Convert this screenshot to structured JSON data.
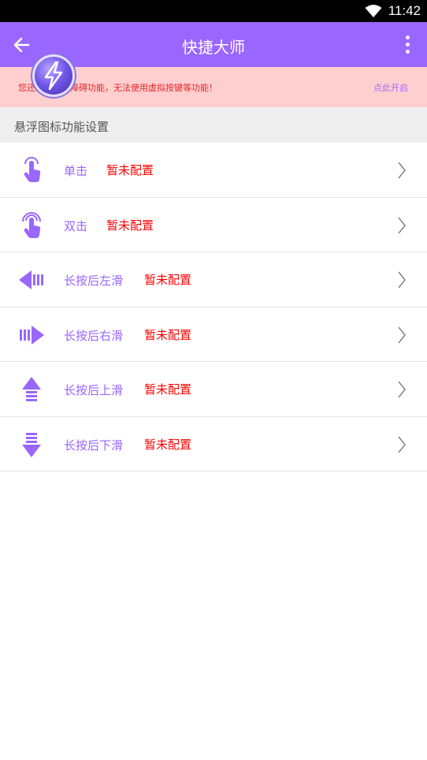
{
  "status": {
    "time": "11:42"
  },
  "appbar": {
    "title": "快捷大师"
  },
  "banner": {
    "message": "您还未开启无障碍功能，无法使用虚拟按键等功能！",
    "action": "点此开启"
  },
  "section": {
    "title": "悬浮图标功能设置"
  },
  "rows": [
    {
      "label": "单击",
      "value": "暂未配置",
      "icon": "single-tap-icon"
    },
    {
      "label": "双击",
      "value": "暂未配置",
      "icon": "double-tap-icon"
    },
    {
      "label": "长按后左滑",
      "value": "暂未配置",
      "icon": "swipe-left-icon"
    },
    {
      "label": "长按后右滑",
      "value": "暂未配置",
      "icon": "swipe-right-icon"
    },
    {
      "label": "长按后上滑",
      "value": "暂未配置",
      "icon": "swipe-up-icon"
    },
    {
      "label": "长按后下滑",
      "value": "暂未配置",
      "icon": "swipe-down-icon"
    }
  ],
  "colors": {
    "primary": "#9966ff",
    "banner_bg": "#ffcfcf",
    "banner_text": "#e0262d",
    "value_text": "#ff0000"
  }
}
